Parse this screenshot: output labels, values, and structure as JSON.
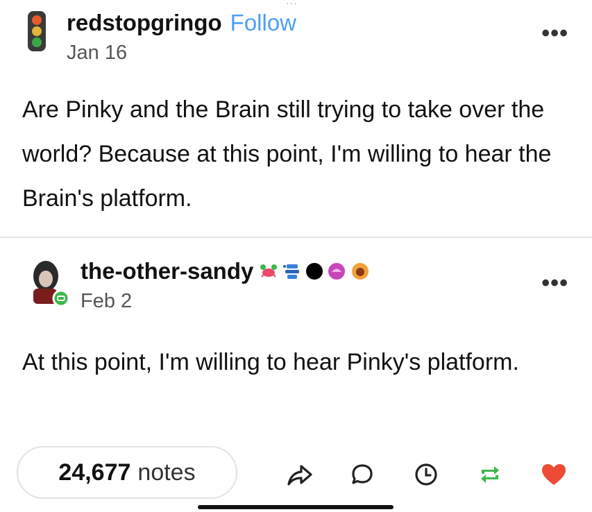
{
  "original_post": {
    "username": "redstopgringo",
    "follow_label": "Follow",
    "date": "Jan 16",
    "text": "Are Pinky and the Brain still trying to take over the world? Because at this point, I'm willing to hear the Brain's platform.",
    "avatar_icon": "traffic-light-icon"
  },
  "reply_post": {
    "username": "the-other-sandy",
    "date": "Feb 2",
    "text": "At this point, I'm willing to hear Pinky's platform.",
    "badges": [
      "crab-badge-icon",
      "blue-robot-badge-icon",
      "black-circle-badge-icon",
      "pink-badge-icon",
      "orange-badge-icon"
    ]
  },
  "footer": {
    "notes_count": "24,677",
    "notes_label": "notes",
    "actions": [
      "share-icon",
      "reply-icon",
      "queue-icon",
      "reblog-icon",
      "like-icon"
    ],
    "colors": {
      "reblog": "#3bb84a",
      "like": "#ec4b34",
      "follow": "#4a9ff5"
    }
  }
}
